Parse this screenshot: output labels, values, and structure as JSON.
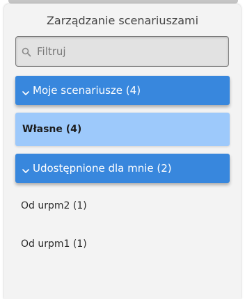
{
  "panel": {
    "title": "Zarządzanie scenariuszami",
    "search": {
      "placeholder": "Filtruj",
      "icon": "search-icon"
    },
    "groups": [
      {
        "label": "Moje scenariusze (4)",
        "icon": "chevron-down-icon",
        "items": [
          {
            "label": "Własne (4)",
            "selected": true
          }
        ]
      },
      {
        "label": "Udostępnione dla mnie (2)",
        "icon": "chevron-down-icon",
        "items": [
          {
            "label": "Od urpm2 (1)",
            "selected": false
          },
          {
            "label": "Od urpm1 (1)",
            "selected": false
          }
        ]
      }
    ]
  },
  "colors": {
    "header_blue": "#3887dd",
    "selected_blue": "#9dc9fb",
    "panel_bg": "#f3f3f3"
  }
}
